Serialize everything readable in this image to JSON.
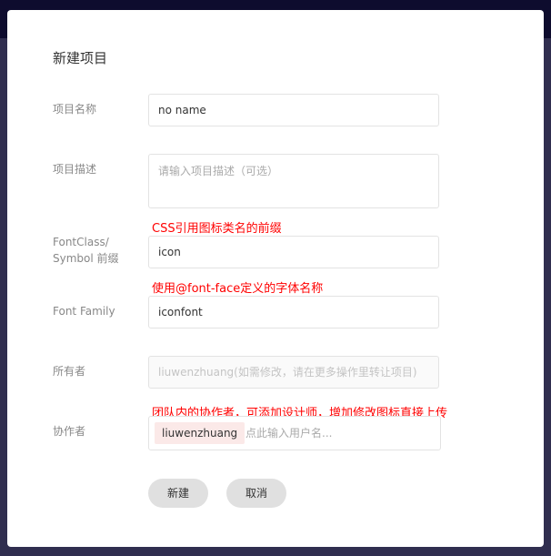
{
  "dialog": {
    "title": "新建项目"
  },
  "fields": {
    "name": {
      "label": "项目名称",
      "value": "no name"
    },
    "description": {
      "label": "项目描述",
      "placeholder": "请输入项目描述（可选）"
    },
    "fontclass": {
      "label_line1": "FontClass/",
      "label_line2": "Symbol 前缀",
      "value": "icon",
      "note": "CSS引用图标类名的前缀"
    },
    "fontfamily": {
      "label": "Font Family",
      "value": "iconfont",
      "note": "使用@font-face定义的字体名称"
    },
    "owner": {
      "label": "所有者",
      "value": "liuwenzhuang(如需修改，请在更多操作里转让项目)"
    },
    "collaborators": {
      "label": "协作者",
      "tags": [
        "liuwenzhuang"
      ],
      "placeholder": "点此输入用户名...",
      "note": "团队内的协作者，可添加设计师，增加修改图标直接上传"
    }
  },
  "buttons": {
    "create": "新建",
    "cancel": "取消"
  }
}
